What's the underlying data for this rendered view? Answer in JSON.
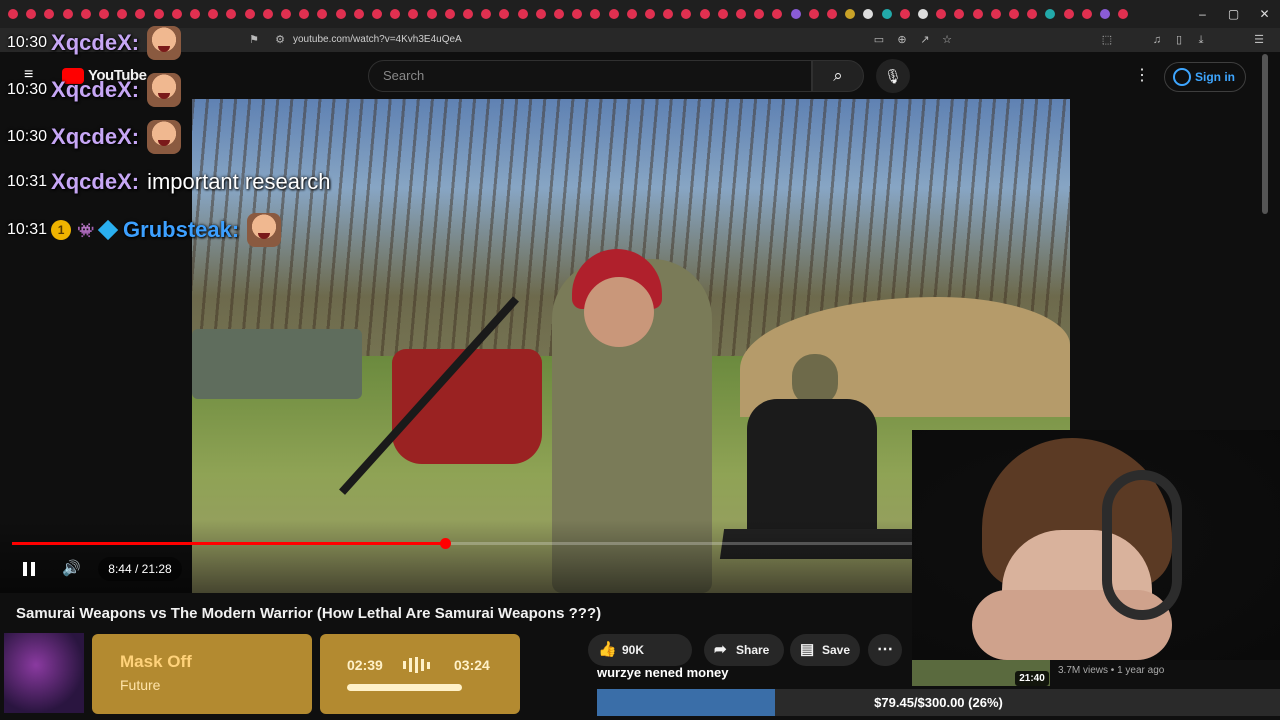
{
  "browser": {
    "url": "youtube.com/watch?v=4Kvh3E4uQeA",
    "window_controls": [
      "–",
      "▢",
      "✕"
    ]
  },
  "header": {
    "logo_text": "YouTube",
    "search_placeholder": "Search",
    "signin_label": "Sign in"
  },
  "chat": [
    {
      "time": "10:30",
      "user": "XqcdeX",
      "message": "",
      "emote": true
    },
    {
      "time": "10:30",
      "user": "XqcdeX",
      "message": "",
      "emote": true
    },
    {
      "time": "10:30",
      "user": "XqcdeX",
      "message": "",
      "emote": true
    },
    {
      "time": "10:31",
      "user": "XqcdeX",
      "message": "important research",
      "emote": false
    },
    {
      "time": "10:31",
      "user": "Grubsteak",
      "message": "",
      "emote": true,
      "badge_number": "1"
    }
  ],
  "player": {
    "time": "8:44 / 21:28",
    "progress": 0.409
  },
  "video": {
    "title": "Samurai Weapons vs The Modern Warrior (How Lethal Are Samurai Weapons ???)",
    "likes": "90K",
    "share_label": "Share",
    "save_label": "Save"
  },
  "now_playing": {
    "title": "Mask Off",
    "artist": "Future",
    "elapsed": "02:39",
    "total": "03:24"
  },
  "donation": {
    "message": "wurzye nened money",
    "goal_text": "$79.45/$300.00 (26%)",
    "fraction": 0.26
  },
  "related": {
    "duration": "21:40",
    "meta": "3.7M views • 1 year ago"
  }
}
